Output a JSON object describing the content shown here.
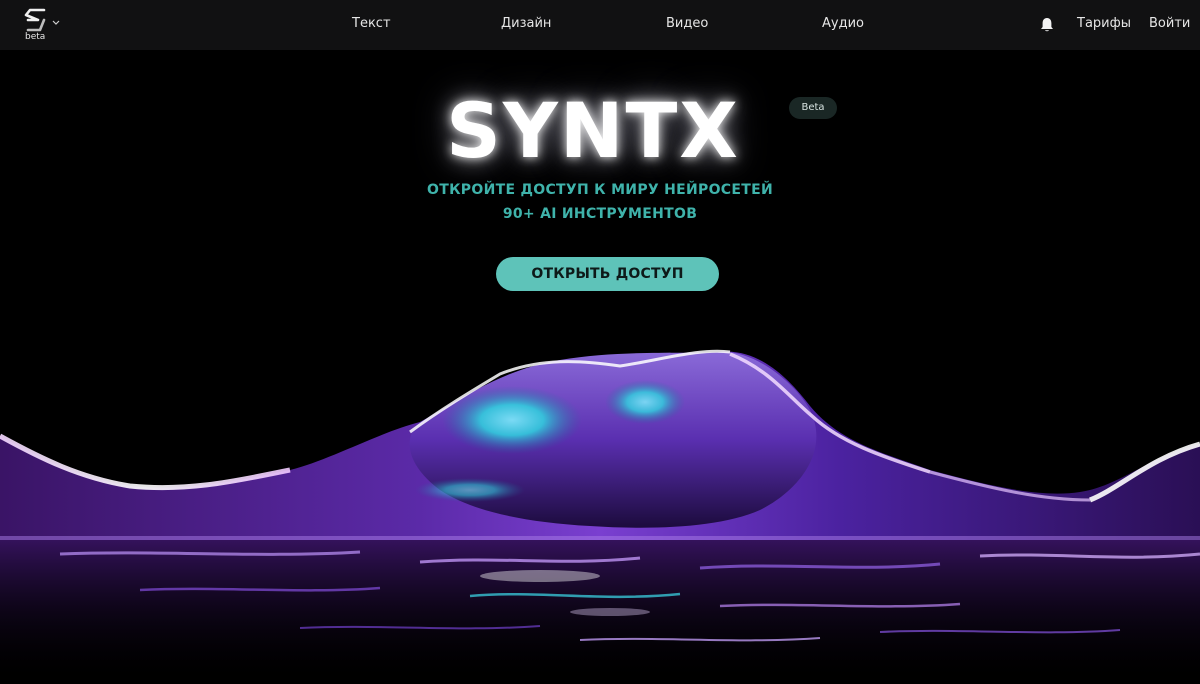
{
  "header": {
    "logo_sub": "beta",
    "nav": {
      "text": "Текст",
      "design": "Дизайн",
      "video": "Видео",
      "audio": "Аудио"
    },
    "bell_icon": "bell-icon",
    "plans": "Тарифы",
    "login": "Войти"
  },
  "hero": {
    "title": "SYNTX",
    "badge": "Beta",
    "tagline_1": "ОТКРОЙТЕ ДОСТУП К МИРУ НЕЙРОСЕТЕЙ",
    "tagline_2": "90+ AI ИНСТРУМЕНТОВ",
    "cta": "ОТКРЫТЬ ДОСТУП"
  },
  "colors": {
    "background": "#000000",
    "topbar": "#111112",
    "accent_teal": "#3fb3ab",
    "cta_bg": "#5ec3b9",
    "wave_purple": "#7a3fd0",
    "wave_cyan": "#2fd6e0"
  }
}
